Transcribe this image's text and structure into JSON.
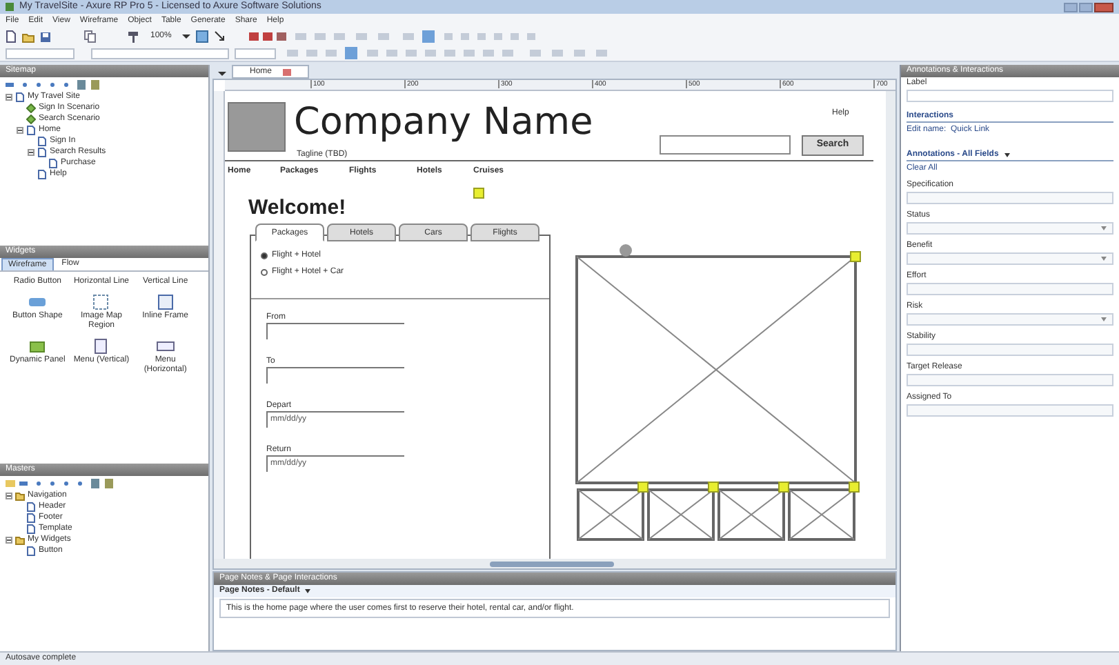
{
  "window": {
    "title": "My TravelSite - Axure RP Pro 5 - Licensed to Axure Software Solutions"
  },
  "menu": [
    "File",
    "Edit",
    "View",
    "Wireframe",
    "Object",
    "Table",
    "Generate",
    "Share",
    "Help"
  ],
  "toolbar": {
    "zoom": "100%"
  },
  "sitemap": {
    "title": "Sitemap",
    "tree": [
      {
        "label": "My Travel Site",
        "kind": "page",
        "expanded": true,
        "children": [
          {
            "label": "Sign In Scenario",
            "kind": "flow"
          },
          {
            "label": "Search Scenario",
            "kind": "flow"
          },
          {
            "label": "Home",
            "kind": "page",
            "expanded": true,
            "children": [
              {
                "label": "Sign In",
                "kind": "page"
              },
              {
                "label": "Search Results",
                "kind": "page",
                "expanded": true,
                "children": [
                  {
                    "label": "Purchase",
                    "kind": "page"
                  }
                ]
              },
              {
                "label": "Help",
                "kind": "page"
              }
            ]
          }
        ]
      }
    ]
  },
  "widgets": {
    "title": "Widgets",
    "tabs": [
      {
        "label": "Wireframe",
        "selected": true
      },
      {
        "label": "Flow",
        "selected": false
      }
    ],
    "items": [
      "Radio Button",
      "Horizontal Line",
      "Vertical Line",
      "Button Shape",
      "Image Map Region",
      "Inline Frame",
      "Dynamic Panel",
      "Menu (Vertical)",
      "Menu (Horizontal)"
    ]
  },
  "masters": {
    "title": "Masters",
    "tree": [
      {
        "label": "Navigation",
        "kind": "folder",
        "expanded": true,
        "children": [
          {
            "label": "Header",
            "kind": "page"
          },
          {
            "label": "Footer",
            "kind": "page"
          },
          {
            "label": "Template",
            "kind": "page"
          }
        ]
      },
      {
        "label": "My Widgets",
        "kind": "folder",
        "expanded": true,
        "children": [
          {
            "label": "Button",
            "kind": "page"
          }
        ]
      }
    ]
  },
  "page_tab": "Home",
  "ruler": [
    "100",
    "200",
    "300",
    "400",
    "500",
    "600",
    "700"
  ],
  "wireframe": {
    "company": "Company Name",
    "tagline": "Tagline (TBD)",
    "help": "Help",
    "search_button": "Search",
    "nav": [
      "Home",
      "Packages",
      "Flights",
      "Hotels",
      "Cruises"
    ],
    "welcome": "Welcome!",
    "tabs": [
      {
        "label": "Packages",
        "selected": true
      },
      {
        "label": "Hotels",
        "selected": false
      },
      {
        "label": "Cars",
        "selected": false
      },
      {
        "label": "Flights",
        "selected": false
      }
    ],
    "options": [
      {
        "label": "Flight + Hotel",
        "selected": true
      },
      {
        "label": "Flight + Hotel + Car",
        "selected": false
      }
    ],
    "fields": [
      {
        "label": "From"
      },
      {
        "label": "To"
      },
      {
        "label": "Depart",
        "value": "mm/dd/yy"
      },
      {
        "label": "Return",
        "value": "mm/dd/yy"
      }
    ]
  },
  "notes": {
    "title": "Page Notes & Page Interactions",
    "section": "Page Notes - Default",
    "text": "This is the home page where the user comes first to reserve their hotel, rental car, and/or flight."
  },
  "annotations": {
    "title": "Annotations & Interactions",
    "label": "Label",
    "interactions": "Interactions",
    "interaction_item": "Edit name:  Quick Link",
    "heading": "Annotations - All Fields",
    "clear": "Clear All",
    "fields": [
      {
        "label": "Specification",
        "kind": "text"
      },
      {
        "label": "Status",
        "kind": "dropdown"
      },
      {
        "label": "Benefit",
        "kind": "dropdown"
      },
      {
        "label": "Effort",
        "kind": "text"
      },
      {
        "label": "Risk",
        "kind": "dropdown"
      },
      {
        "label": "Stability",
        "kind": "text"
      },
      {
        "label": "Target Release",
        "kind": "text"
      },
      {
        "label": "Assigned To",
        "kind": "text"
      }
    ]
  },
  "status_bar": "Autosave complete"
}
